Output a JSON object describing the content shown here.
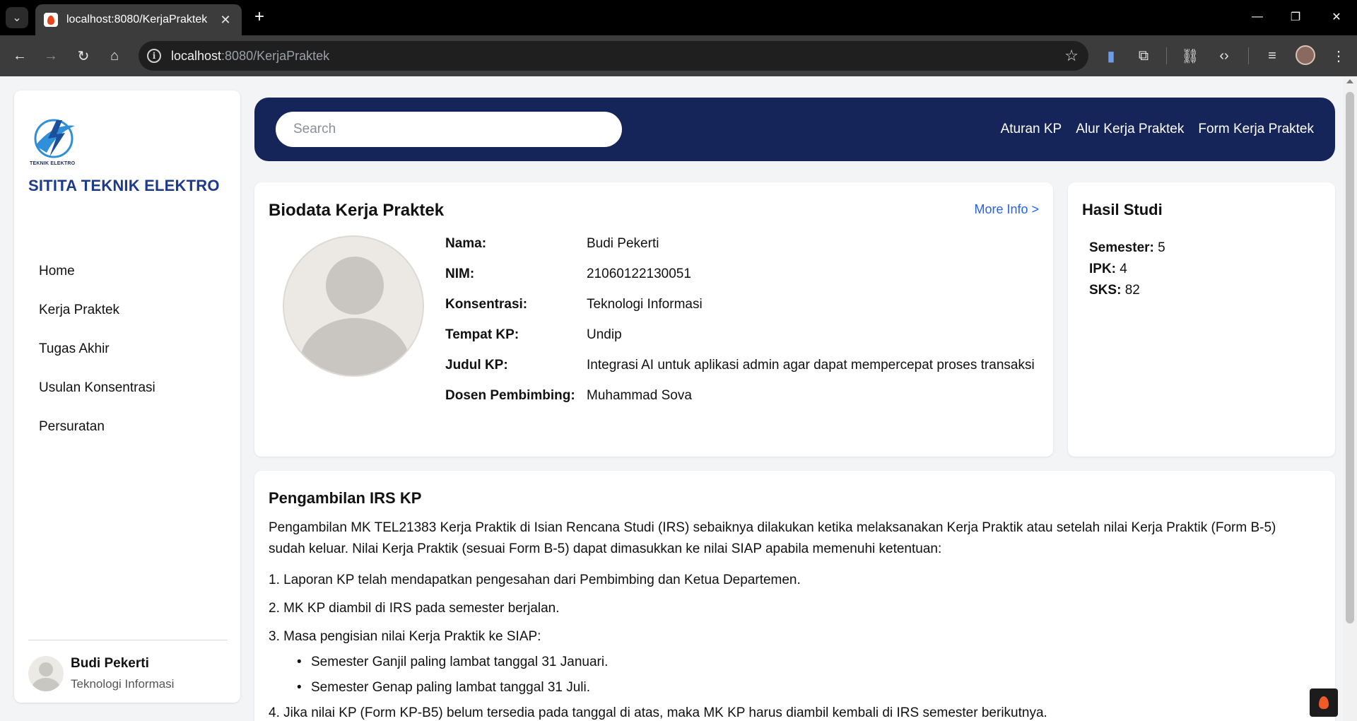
{
  "browser": {
    "tab_title": "localhost:8080/KerjaPraktek",
    "tab_close": "✕",
    "new_tab": "+",
    "url_host": "localhost",
    "url_rest": ":8080/KerjaPraktek",
    "minimize": "—",
    "restore": "❐",
    "close": "✕"
  },
  "sidebar": {
    "logo_text": "TEKNIK ELEKTRO",
    "brand": "SITITA TEKNIK ELEKTRO",
    "nav": [
      {
        "label": "Home"
      },
      {
        "label": "Kerja Praktek"
      },
      {
        "label": "Tugas Akhir"
      },
      {
        "label": "Usulan Konsentrasi"
      },
      {
        "label": "Persuratan"
      }
    ],
    "user": {
      "name": "Budi Pekerti",
      "concentration": "Teknologi Informasi"
    }
  },
  "topbar": {
    "search_placeholder": "Search",
    "links": [
      {
        "label": "Aturan KP"
      },
      {
        "label": "Alur Kerja Praktek"
      },
      {
        "label": "Form Kerja Praktek"
      }
    ]
  },
  "biodata": {
    "title": "Biodata Kerja Praktek",
    "more_info": "More Info >",
    "rows": [
      {
        "label": "Nama:",
        "value": "Budi Pekerti"
      },
      {
        "label": "NIM:",
        "value": "21060122130051"
      },
      {
        "label": "Konsentrasi:",
        "value": "Teknologi Informasi"
      },
      {
        "label": "Tempat KP:",
        "value": "Undip"
      },
      {
        "label": "Judul KP:",
        "value": "Integrasi AI untuk aplikasi admin agar dapat mempercepat proses transaksi"
      },
      {
        "label": "Dosen Pembimbing:",
        "value": "Muhammad Sova"
      }
    ]
  },
  "hasil_studi": {
    "title": "Hasil Studi",
    "items": [
      {
        "label": "Semester:",
        "value": "5"
      },
      {
        "label": "IPK:",
        "value": "4"
      },
      {
        "label": "SKS:",
        "value": "82"
      }
    ]
  },
  "irs": {
    "title": "Pengambilan IRS KP",
    "paragraph": "Pengambilan MK TEL21383 Kerja Praktik di Isian Rencana Studi (IRS) sebaiknya dilakukan ketika melaksanakan Kerja Praktik atau setelah nilai Kerja Praktik (Form B-5) sudah keluar. Nilai Kerja Praktik (sesuai Form B-5) dapat dimasukkan ke nilai SIAP apabila memenuhi ketentuan:",
    "items": [
      "1. Laporan KP telah mendapatkan pengesahan dari Pembimbing dan Ketua Departemen.",
      "2. MK KP diambil di IRS pada semester berjalan.",
      "3. Masa pengisian nilai Kerja Praktik ke SIAP:"
    ],
    "subitems": [
      "Semester Ganjil paling lambat tanggal 31 Januari.",
      "Semester Genap paling lambat tanggal 31 Juli."
    ],
    "item4": "4. Jika nilai KP (Form KP-B5) belum tersedia pada tanggal di atas, maka MK KP harus diambil kembali di IRS semester berikutnya."
  }
}
